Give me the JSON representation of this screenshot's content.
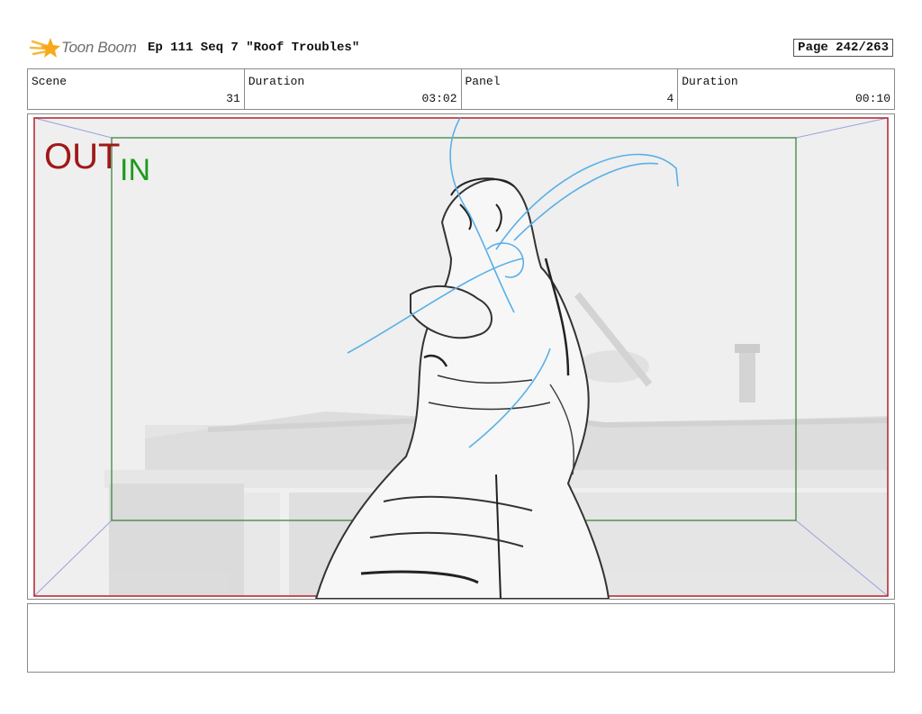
{
  "header": {
    "logo_text": "Toon Boom",
    "title": "Ep 111 Seq 7 \"Roof Troubles\"",
    "page": "Page 242/263"
  },
  "info": [
    {
      "label": "Scene",
      "value": "31"
    },
    {
      "label": "Duration",
      "value": "03:02"
    },
    {
      "label": "Panel",
      "value": "4"
    },
    {
      "label": "Duration",
      "value": "00:10"
    }
  ],
  "panel": {
    "out_label": "OUT",
    "in_label": "IN"
  },
  "notes": {
    "text": ""
  },
  "colors": {
    "out_frame": "#b0202a",
    "in_frame": "#2e7d32",
    "perspective_lines": "#9aa0e0",
    "sketch_blue": "#5ab0e8",
    "logo_orange": "#f5a623"
  }
}
